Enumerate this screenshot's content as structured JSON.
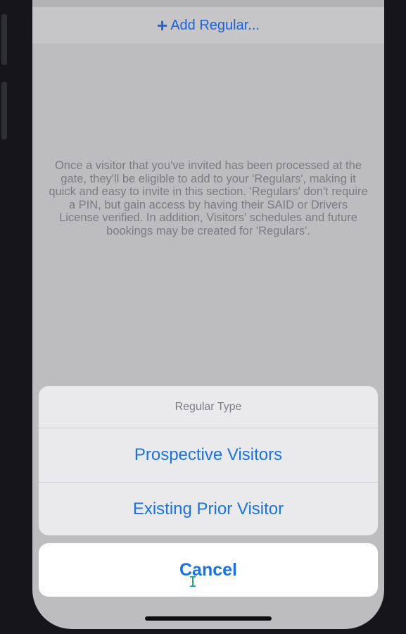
{
  "header": {
    "add_regular_label": "Add Regular...",
    "add_icon": "plus-icon"
  },
  "main": {
    "info_text": "Once a visitor that you've invited has been processed at the gate, they'll be eligible to add to your 'Regulars', making it quick and easy to invite in this section. 'Regulars' don't require a PIN, but gain access by having their SAID or Drivers License verified. In addition, Visitors' schedules and future bookings may be created for 'Regulars'."
  },
  "action_sheet": {
    "title": "Regular Type",
    "options": [
      {
        "label": "Prospective Visitors"
      },
      {
        "label": "Existing Prior Visitor"
      }
    ],
    "cancel_label": "Cancel"
  },
  "colors": {
    "accent": "#1a73e0",
    "overlay_background": "#bdbdbf",
    "sheet_background": "#eaeaed"
  }
}
